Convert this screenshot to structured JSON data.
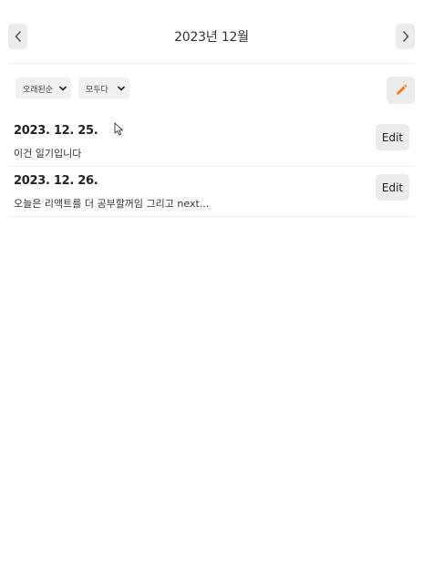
{
  "header": {
    "title": "2023년 12월",
    "prev_icon": "chevron-left-icon",
    "next_icon": "chevron-right-icon"
  },
  "filters": {
    "sort": {
      "selected": "오래된순"
    },
    "emotion": {
      "selected": "모두다"
    }
  },
  "write_button": {
    "icon": "pencil-icon",
    "icon_color": "#f47a1f"
  },
  "diaries": [
    {
      "date": "2023. 12. 25.",
      "content": "이건 일기입니다",
      "edit_label": "Edit"
    },
    {
      "date": "2023. 12. 26.",
      "content": "오늘은 리액트를 더 공부할꺼임 그리고 next...",
      "edit_label": "Edit"
    }
  ]
}
